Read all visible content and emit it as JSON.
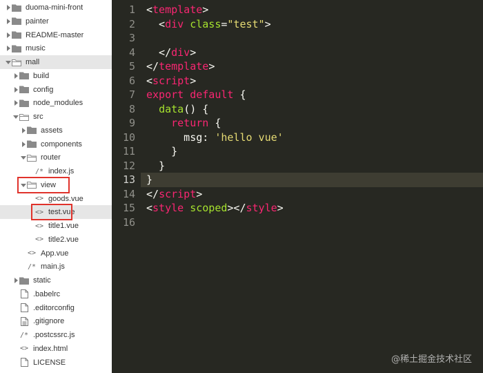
{
  "sidebar": {
    "items": [
      {
        "label": "duoma-mini-front",
        "type": "folder",
        "state": "closed",
        "depth": 0
      },
      {
        "label": "painter",
        "type": "folder",
        "state": "closed",
        "depth": 0
      },
      {
        "label": "README-master",
        "type": "folder",
        "state": "closed",
        "depth": 0
      },
      {
        "label": "music",
        "type": "folder",
        "state": "closed",
        "depth": 0
      },
      {
        "label": "mall",
        "type": "folder",
        "state": "open",
        "depth": 0,
        "selected": true
      },
      {
        "label": "build",
        "type": "folder",
        "state": "closed",
        "depth": 1
      },
      {
        "label": "config",
        "type": "folder",
        "state": "closed",
        "depth": 1
      },
      {
        "label": "node_modules",
        "type": "folder",
        "state": "closed",
        "depth": 1
      },
      {
        "label": "src",
        "type": "folder",
        "state": "open",
        "depth": 1
      },
      {
        "label": "assets",
        "type": "folder",
        "state": "closed",
        "depth": 2
      },
      {
        "label": "components",
        "type": "folder",
        "state": "closed",
        "depth": 2
      },
      {
        "label": "router",
        "type": "folder",
        "state": "open",
        "depth": 2
      },
      {
        "label": "index.js",
        "type": "file",
        "glyph": "/*",
        "depth": 3
      },
      {
        "label": "view",
        "type": "folder",
        "state": "open",
        "depth": 2,
        "highlighted": true
      },
      {
        "label": "goods.vue",
        "type": "file",
        "glyph": "<>",
        "depth": 3
      },
      {
        "label": "test.vue",
        "type": "file",
        "glyph": "<>",
        "depth": 3,
        "selected": true,
        "highlighted": true
      },
      {
        "label": "title1.vue",
        "type": "file",
        "glyph": "<>",
        "depth": 3
      },
      {
        "label": "title2.vue",
        "type": "file",
        "glyph": "<>",
        "depth": 3
      },
      {
        "label": "App.vue",
        "type": "file",
        "glyph": "<>",
        "depth": 2
      },
      {
        "label": "main.js",
        "type": "file",
        "glyph": "/*",
        "depth": 2
      },
      {
        "label": "static",
        "type": "folder",
        "state": "closed",
        "depth": 1
      },
      {
        "label": ".babelrc",
        "type": "file",
        "glyph": "doc",
        "depth": 1
      },
      {
        "label": ".editorconfig",
        "type": "file",
        "glyph": "doc",
        "depth": 1
      },
      {
        "label": ".gitignore",
        "type": "file",
        "glyph": "lines",
        "depth": 1
      },
      {
        "label": ".postcssrc.js",
        "type": "file",
        "glyph": "/*",
        "depth": 1
      },
      {
        "label": "index.html",
        "type": "file",
        "glyph": "<>",
        "depth": 1
      },
      {
        "label": "LICENSE",
        "type": "file",
        "glyph": "doc",
        "depth": 1
      }
    ]
  },
  "editor": {
    "current_line": 13,
    "lines": [
      {
        "num": "1",
        "tokens": [
          {
            "t": "<",
            "c": "text"
          },
          {
            "t": "template",
            "c": "tag"
          },
          {
            "t": ">",
            "c": "text"
          }
        ]
      },
      {
        "num": "2",
        "tokens": [
          {
            "t": "  <",
            "c": "text"
          },
          {
            "t": "div",
            "c": "tag"
          },
          {
            "t": " ",
            "c": "text"
          },
          {
            "t": "class",
            "c": "attr"
          },
          {
            "t": "=",
            "c": "text"
          },
          {
            "t": "\"test\"",
            "c": "str"
          },
          {
            "t": ">",
            "c": "text"
          }
        ]
      },
      {
        "num": "3",
        "tokens": []
      },
      {
        "num": "4",
        "tokens": [
          {
            "t": "  </",
            "c": "text"
          },
          {
            "t": "div",
            "c": "tag"
          },
          {
            "t": ">",
            "c": "text"
          }
        ]
      },
      {
        "num": "5",
        "tokens": [
          {
            "t": "</",
            "c": "text"
          },
          {
            "t": "template",
            "c": "tag"
          },
          {
            "t": ">",
            "c": "text"
          }
        ]
      },
      {
        "num": "6",
        "tokens": [
          {
            "t": "<",
            "c": "text"
          },
          {
            "t": "script",
            "c": "tag"
          },
          {
            "t": ">",
            "c": "text"
          }
        ]
      },
      {
        "num": "7",
        "tokens": [
          {
            "t": "export",
            "c": "kw"
          },
          {
            "t": " ",
            "c": "text"
          },
          {
            "t": "default",
            "c": "kw"
          },
          {
            "t": " {",
            "c": "text"
          }
        ]
      },
      {
        "num": "8",
        "tokens": [
          {
            "t": "  ",
            "c": "text"
          },
          {
            "t": "data",
            "c": "fn"
          },
          {
            "t": "() {",
            "c": "text"
          }
        ]
      },
      {
        "num": "9",
        "tokens": [
          {
            "t": "    ",
            "c": "text"
          },
          {
            "t": "return",
            "c": "kw"
          },
          {
            "t": " {",
            "c": "text"
          }
        ]
      },
      {
        "num": "10",
        "tokens": [
          {
            "t": "      msg: ",
            "c": "text"
          },
          {
            "t": "'hello vue'",
            "c": "str"
          }
        ]
      },
      {
        "num": "11",
        "tokens": [
          {
            "t": "    }",
            "c": "text"
          }
        ]
      },
      {
        "num": "12",
        "tokens": [
          {
            "t": "  }",
            "c": "text"
          }
        ]
      },
      {
        "num": "13",
        "tokens": [
          {
            "t": "}",
            "c": "text"
          }
        ]
      },
      {
        "num": "14",
        "tokens": [
          {
            "t": "</",
            "c": "text"
          },
          {
            "t": "script",
            "c": "tag"
          },
          {
            "t": ">",
            "c": "text"
          }
        ]
      },
      {
        "num": "15",
        "tokens": [
          {
            "t": "<",
            "c": "text"
          },
          {
            "t": "style",
            "c": "tag"
          },
          {
            "t": " ",
            "c": "text"
          },
          {
            "t": "scoped",
            "c": "attr"
          },
          {
            "t": "></",
            "c": "text"
          },
          {
            "t": "style",
            "c": "tag"
          },
          {
            "t": ">",
            "c": "text"
          }
        ]
      },
      {
        "num": "16",
        "tokens": []
      }
    ]
  },
  "watermark": "@稀土掘金技术社区",
  "colors": {
    "editor_bg": "#272822",
    "current_line_bg": "#3e3d32",
    "highlight_box": "#e0322b",
    "tag": "#f92672",
    "attr": "#a6e22e",
    "string": "#e6db74"
  }
}
